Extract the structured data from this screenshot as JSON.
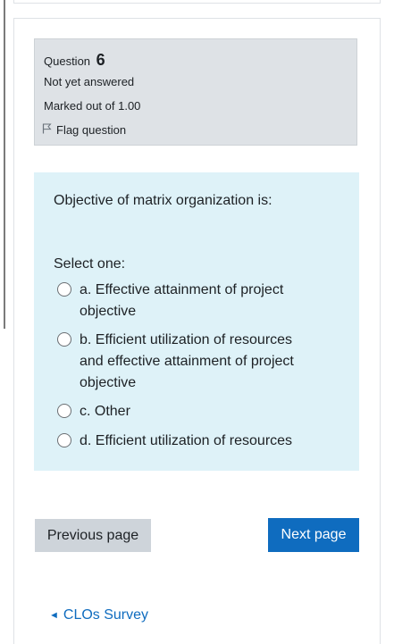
{
  "question": {
    "label": "Question",
    "number": "6",
    "state": "Not yet answered",
    "grade": "Marked out of 1.00",
    "flag_label": "Flag question",
    "text": "Objective of matrix organization is:",
    "prompt": "Select one:",
    "answers": [
      {
        "label": "a. Effective attainment of project objective"
      },
      {
        "label": "b. Efficient utilization of resources and effective attainment of project objective"
      },
      {
        "label": "c. Other"
      },
      {
        "label": "d. Efficient utilization of resources"
      }
    ]
  },
  "nav": {
    "previous_label": "Previous page",
    "next_label": "Next page",
    "activity_link": "CLOs Survey",
    "activity_arrow": "◄"
  },
  "colors": {
    "info_bg": "#dee2e6",
    "content_bg": "#def2f8",
    "primary": "#0f6cbf",
    "secondary": "#ced4da"
  }
}
